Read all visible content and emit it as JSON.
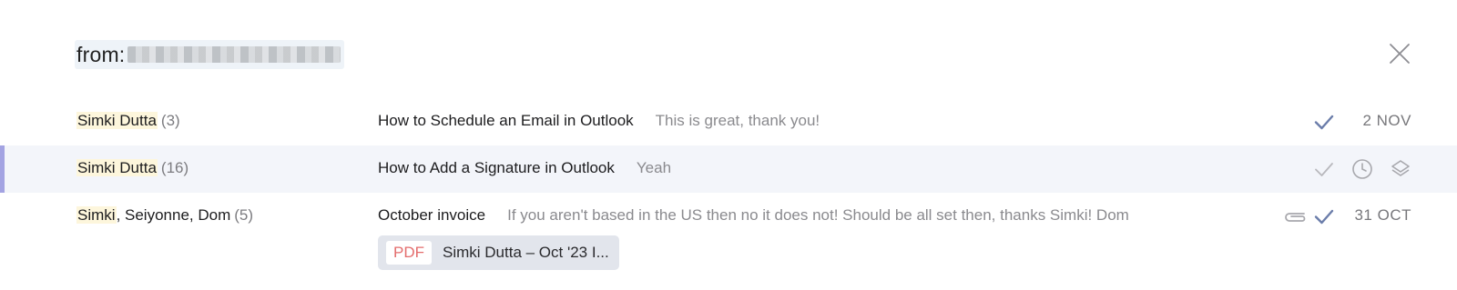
{
  "search": {
    "prefix": "from:",
    "redacted_value": ""
  },
  "threads": [
    {
      "sender_highlight": "Simki Dutta",
      "sender_rest": "",
      "count": "(3)",
      "subject": "How to Schedule an Email in Outlook",
      "snippet": "This is great, thank you!",
      "date": "2 NOV",
      "icons": [
        "check-icon"
      ]
    },
    {
      "sender_highlight": "Simki Dutta",
      "sender_rest": "",
      "count": "(16)",
      "subject": "How to Add a Signature in Outlook",
      "snippet": "Yeah",
      "date": "",
      "icons": [
        "check-icon",
        "clock-icon",
        "layers-icon"
      ],
      "selected": true
    },
    {
      "sender_highlight": "Simki",
      "sender_rest": ", Seiyonne, Dom",
      "count": "(5)",
      "subject": "October invoice",
      "snippet": "If you aren't based in the US then no it does not! Should be all set then, thanks Simki! Dom",
      "date": "31 OCT",
      "icons": [
        "paperclip-icon",
        "check-icon"
      ],
      "attachment": {
        "type": "PDF",
        "name": "Simki Dutta – Oct '23 I..."
      }
    }
  ],
  "colors": {
    "accent": "#a3a3e2",
    "highlight": "#fdf6dc",
    "selected_row": "#f3f5fa",
    "pdf": "#e46d6d"
  }
}
